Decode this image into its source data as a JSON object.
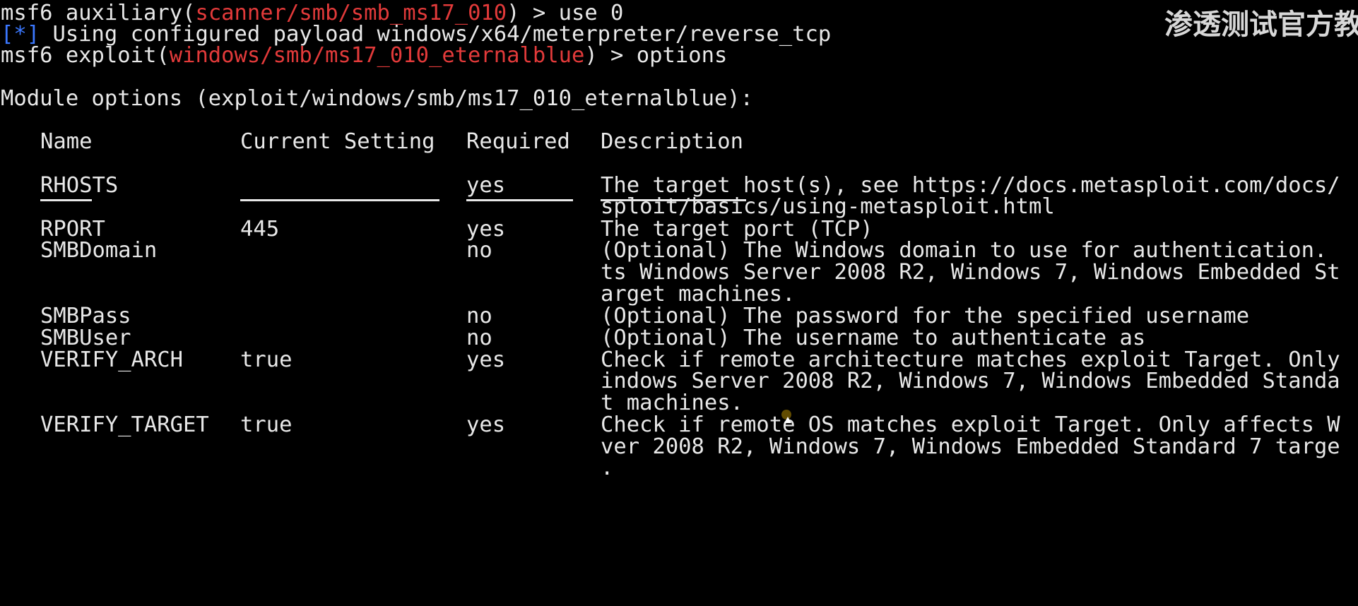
{
  "watermark": "渗透测试官方教",
  "lines": {
    "l1_prefix": "msf6 auxiliary(",
    "l1_module": "scanner/smb/smb_ms17_010",
    "l1_suffix": ") > use 0",
    "l2_tag": "[*]",
    "l2_text": " Using configured payload windows/x64/meterpreter/reverse_tcp",
    "l3_prefix": "msf6 exploit(",
    "l3_module": "windows/smb/ms17_010_eternalblue",
    "l3_suffix": ") > options",
    "l4": "Module options (exploit/windows/smb/ms17_010_eternalblue):"
  },
  "table": {
    "headers": {
      "name": "Name",
      "current": "Current Setting",
      "required": "Required",
      "description": "Description"
    },
    "rows": [
      {
        "name": "RHOSTS",
        "current": "",
        "required": "yes",
        "desc": [
          "The target host(s), see https://docs.metasploit.com/docs/",
          "sploit/basics/using-metasploit.html"
        ]
      },
      {
        "name": "RPORT",
        "current": "445",
        "required": "yes",
        "desc": [
          "The target port (TCP)"
        ]
      },
      {
        "name": "SMBDomain",
        "current": "",
        "required": "no",
        "desc": [
          "(Optional) The Windows domain to use for authentication.",
          "ts Windows Server 2008 R2, Windows 7, Windows Embedded St",
          "arget machines."
        ]
      },
      {
        "name": "SMBPass",
        "current": "",
        "required": "no",
        "desc": [
          "(Optional) The password for the specified username"
        ]
      },
      {
        "name": "SMBUser",
        "current": "",
        "required": "no",
        "desc": [
          "(Optional) The username to authenticate as"
        ]
      },
      {
        "name": "VERIFY_ARCH",
        "current": "true",
        "required": "yes",
        "desc": [
          "Check if remote architecture matches exploit Target. Only",
          "indows Server 2008 R2, Windows 7, Windows Embedded Standa",
          "t machines."
        ]
      },
      {
        "name": "VERIFY_TARGET",
        "current": "true",
        "required": "yes",
        "desc": [
          "Check if remote OS matches exploit Target. Only affects W",
          "ver 2008 R2, Windows 7, Windows Embedded Standard 7 targe",
          "."
        ]
      }
    ]
  },
  "colors": {
    "background": "#000000",
    "text": "#e8e8e8",
    "module_red": "#e23a3a",
    "info_blue": "#3b78ff"
  }
}
